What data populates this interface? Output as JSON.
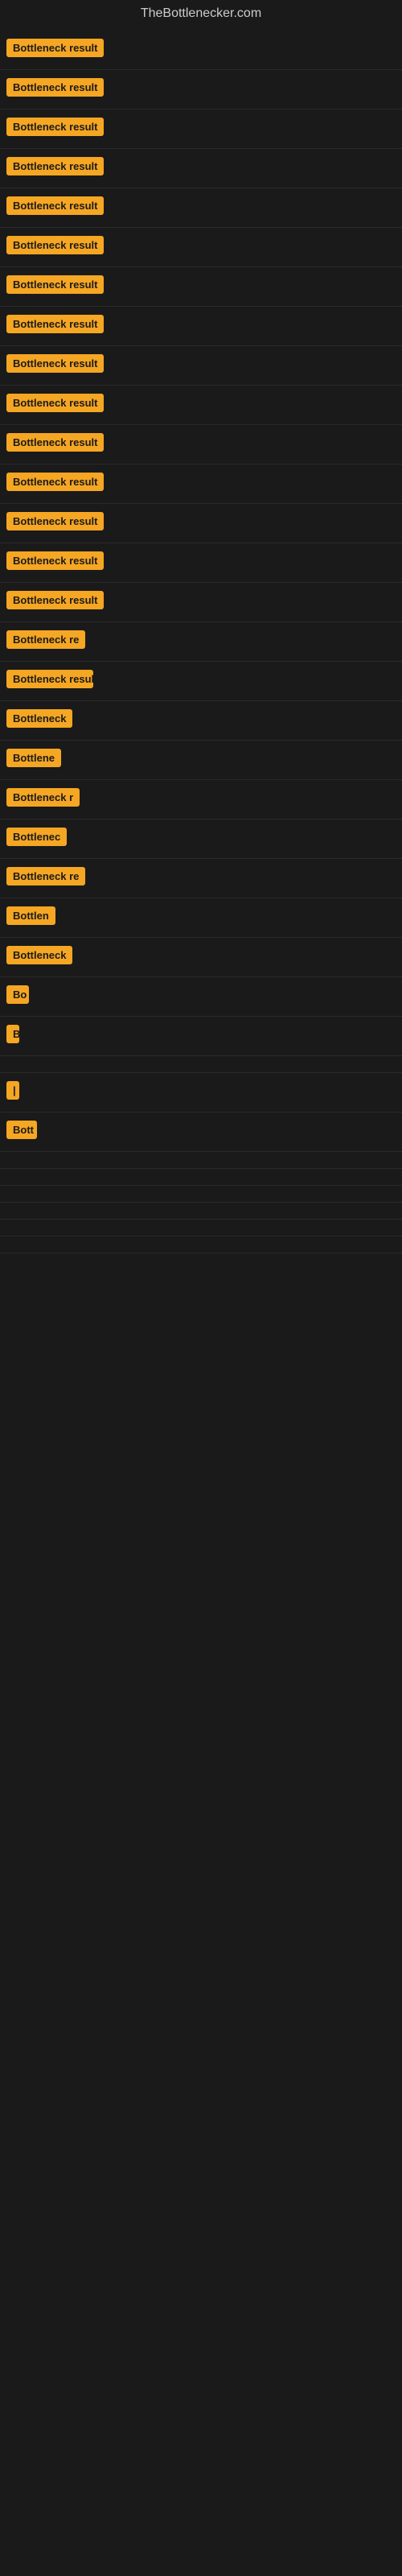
{
  "site": {
    "title": "TheBottlenecker.com"
  },
  "rows": [
    {
      "id": 1,
      "label": "Bottleneck result",
      "width": 130,
      "visible": true
    },
    {
      "id": 2,
      "label": "Bottleneck result",
      "width": 130,
      "visible": true
    },
    {
      "id": 3,
      "label": "Bottleneck result",
      "width": 130,
      "visible": true
    },
    {
      "id": 4,
      "label": "Bottleneck result",
      "width": 130,
      "visible": true
    },
    {
      "id": 5,
      "label": "Bottleneck result",
      "width": 130,
      "visible": true
    },
    {
      "id": 6,
      "label": "Bottleneck result",
      "width": 130,
      "visible": true
    },
    {
      "id": 7,
      "label": "Bottleneck result",
      "width": 130,
      "visible": true
    },
    {
      "id": 8,
      "label": "Bottleneck result",
      "width": 130,
      "visible": true
    },
    {
      "id": 9,
      "label": "Bottleneck result",
      "width": 130,
      "visible": true
    },
    {
      "id": 10,
      "label": "Bottleneck result",
      "width": 130,
      "visible": true
    },
    {
      "id": 11,
      "label": "Bottleneck result",
      "width": 130,
      "visible": true
    },
    {
      "id": 12,
      "label": "Bottleneck result",
      "width": 130,
      "visible": true
    },
    {
      "id": 13,
      "label": "Bottleneck result",
      "width": 130,
      "visible": true
    },
    {
      "id": 14,
      "label": "Bottleneck result",
      "width": 130,
      "visible": true
    },
    {
      "id": 15,
      "label": "Bottleneck result",
      "width": 130,
      "visible": true
    },
    {
      "id": 16,
      "label": "Bottleneck re",
      "width": 105,
      "visible": true
    },
    {
      "id": 17,
      "label": "Bottleneck resul",
      "width": 108,
      "visible": true
    },
    {
      "id": 18,
      "label": "Bottleneck",
      "width": 85,
      "visible": true
    },
    {
      "id": 19,
      "label": "Bottlene",
      "width": 70,
      "visible": true
    },
    {
      "id": 20,
      "label": "Bottleneck r",
      "width": 92,
      "visible": true
    },
    {
      "id": 21,
      "label": "Bottlenec",
      "width": 75,
      "visible": true
    },
    {
      "id": 22,
      "label": "Bottleneck re",
      "width": 100,
      "visible": true
    },
    {
      "id": 23,
      "label": "Bottlen",
      "width": 65,
      "visible": true
    },
    {
      "id": 24,
      "label": "Bottleneck",
      "width": 85,
      "visible": true
    },
    {
      "id": 25,
      "label": "Bo",
      "width": 28,
      "visible": true
    },
    {
      "id": 26,
      "label": "B",
      "width": 14,
      "visible": true
    },
    {
      "id": 27,
      "label": "",
      "width": 8,
      "visible": true
    },
    {
      "id": 28,
      "label": "|",
      "width": 8,
      "visible": true
    },
    {
      "id": 29,
      "label": "Bott",
      "width": 38,
      "visible": true
    },
    {
      "id": 30,
      "label": "",
      "width": 0,
      "visible": false
    },
    {
      "id": 31,
      "label": "",
      "width": 0,
      "visible": false
    },
    {
      "id": 32,
      "label": "",
      "width": 0,
      "visible": false
    },
    {
      "id": 33,
      "label": "",
      "width": 0,
      "visible": false
    },
    {
      "id": 34,
      "label": "",
      "width": 0,
      "visible": false
    },
    {
      "id": 35,
      "label": "",
      "width": 0,
      "visible": false
    }
  ]
}
